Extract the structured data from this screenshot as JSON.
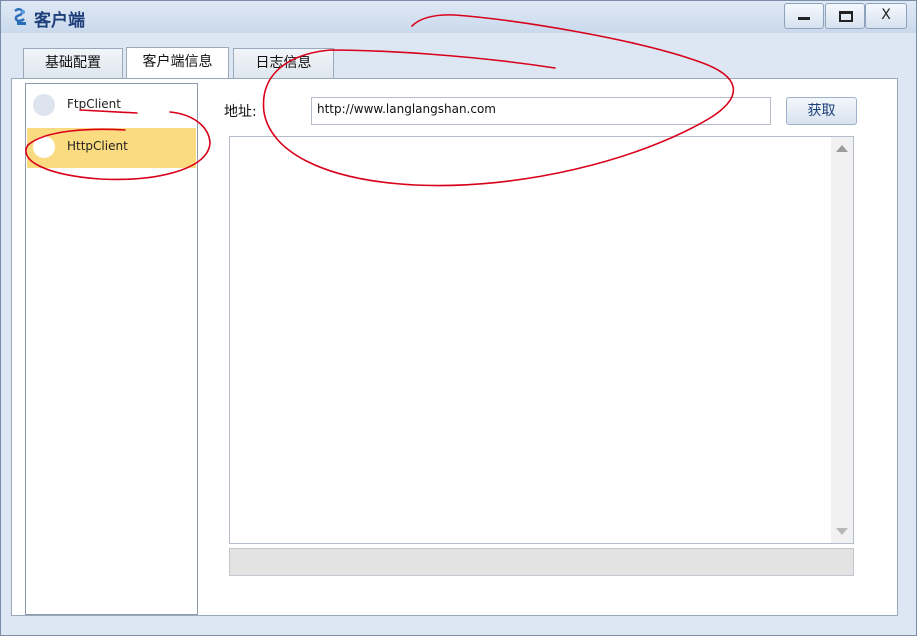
{
  "window": {
    "title": "客户端",
    "controls": {
      "minimize": "minimize",
      "maximize": "maximize",
      "close_label": "X"
    }
  },
  "tabs": [
    {
      "label": "基础配置",
      "active": false
    },
    {
      "label": "客户端信息",
      "active": true
    },
    {
      "label": "日志信息",
      "active": false
    }
  ],
  "client_list": {
    "items": [
      {
        "label": "FtpClient",
        "selected": false
      },
      {
        "label": "HttpClient",
        "selected": true
      }
    ]
  },
  "address": {
    "label": "地址:",
    "value": "http://www.langlangshan.com"
  },
  "fetch_button": {
    "label": "获取"
  },
  "colors": {
    "selected_item": "#fbdb80",
    "annotation_stroke": "#d9001b",
    "title_text": "#1e3f7a"
  }
}
